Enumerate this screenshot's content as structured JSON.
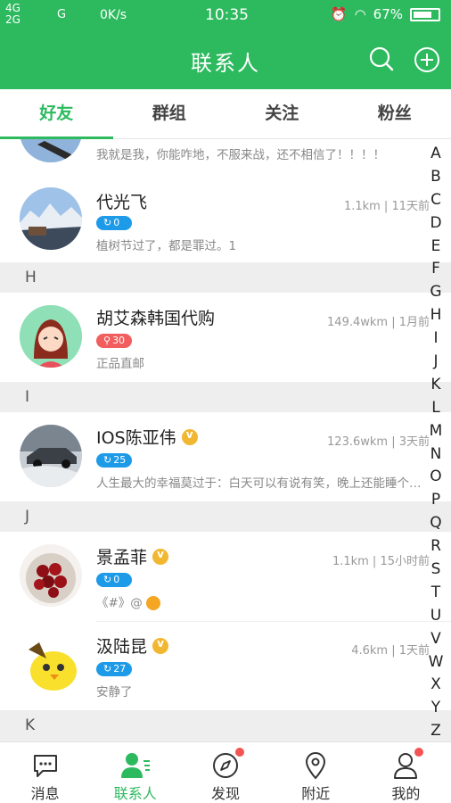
{
  "status": {
    "net1": "4G",
    "net2": "2G",
    "net3": "G",
    "speed": "0K/s",
    "time": "10:35",
    "battery": "67%"
  },
  "header": {
    "title": "联系人"
  },
  "tabs": [
    "好友",
    "群组",
    "关注",
    "粉丝"
  ],
  "contacts": [
    {
      "signature": "我就是我，你能咋地，不服来战，还不相信了！！！！"
    },
    {
      "name": "代光飞",
      "meta": "1.1km | 11天前",
      "badge": "0",
      "signature": "植树节过了，都是罪过。1"
    },
    {
      "section": "H"
    },
    {
      "name": "胡艾森韩国代购",
      "meta": "149.4wkm | 1月前",
      "badge": "30",
      "signature": "正品直邮"
    },
    {
      "section": "I"
    },
    {
      "name": "IOS陈亚伟",
      "meta": "123.6wkm | 3天前",
      "badge": "25",
      "signature": "人生最大的幸福莫过于：白天可以有说有笑，晚上还能睡个好觉"
    },
    {
      "section": "J"
    },
    {
      "name": "景孟菲",
      "meta": "1.1km | 15小时前",
      "badge": "0",
      "signature": "《#》@"
    },
    {
      "name": "汲陆昆",
      "meta": "4.6km | 1天前",
      "badge": "27",
      "signature": "安静了"
    },
    {
      "section": "K"
    }
  ],
  "index": [
    "A",
    "B",
    "C",
    "D",
    "E",
    "F",
    "G",
    "H",
    "I",
    "J",
    "K",
    "L",
    "M",
    "N",
    "O",
    "P",
    "Q",
    "R",
    "S",
    "T",
    "U",
    "V",
    "W",
    "X",
    "Y",
    "Z"
  ],
  "nav": [
    "消息",
    "联系人",
    "发现",
    "附近",
    "我的"
  ],
  "colors": {
    "accent": "#2dba5f",
    "badge_blue": "#1e9be8",
    "badge_red": "#f25d5d",
    "notify": "#f45353"
  }
}
